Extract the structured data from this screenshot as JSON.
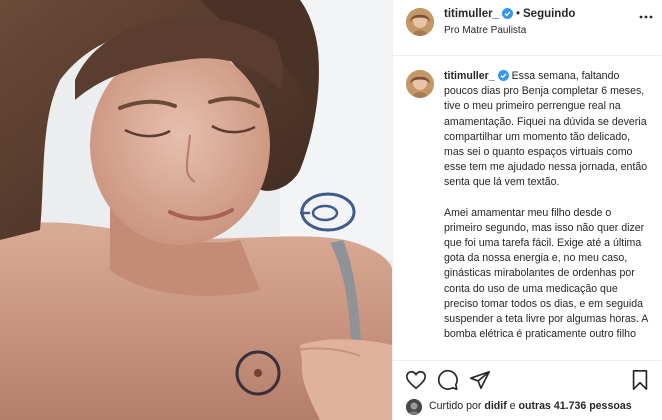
{
  "header": {
    "username": "titimuller_",
    "separator": "•",
    "follow_label": "Seguindo",
    "location": "Pro Matre Paulista"
  },
  "caption": {
    "username": "titimuller_",
    "paragraph_1": "Essa semana, faltando poucos dias pro Benja completar 6 meses, tive o meu primeiro perrengue real na amamentação. Fiquei na dúvida se deveria compartilhar um momento tão delicado, mas sei o quanto espaços virtuais como esse tem me ajudado nessa jornada, então senta que lá vem textão.",
    "paragraph_2": "Amei amamentar meu filho desde o primeiro segundo, mas isso não quer dizer que foi uma tarefa fácil. Exige até a última gota da nossa energia e, no meu caso, ginásticas mirabolantes de ordenhas por conta do uso de uma medicação que preciso tomar todos os dias, e em seguida suspender a teta livre por algumas horas. A bomba elétrica é praticamente outro filho"
  },
  "likes": {
    "prefix": "Curtido por",
    "user": "didif",
    "connector": "e",
    "count_text": "outras 41.736 pessoas"
  },
  "icons": {
    "verified": "verified-badge-icon",
    "more": "more-options-icon",
    "like": "heart-icon",
    "comment": "comment-icon",
    "share": "share-icon",
    "save": "bookmark-icon"
  },
  "colors": {
    "verified_blue": "#3897f0",
    "text": "#262626",
    "divider": "#efefef"
  }
}
